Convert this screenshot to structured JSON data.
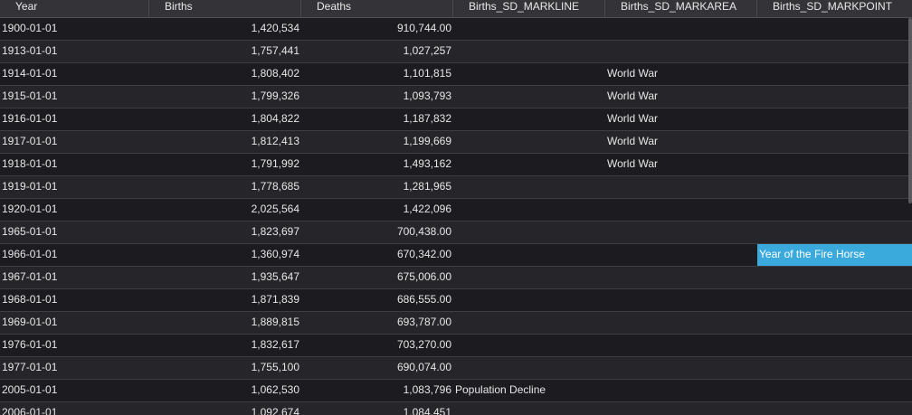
{
  "columns": [
    "Year",
    "Births",
    "Deaths",
    "Births_SD_MARKLINE",
    "Births_SD_MARKAREA",
    "Births_SD_MARKPOINT"
  ],
  "rows": [
    [
      "1900-01-01",
      "1,420,534",
      "910,744.00",
      "",
      "",
      ""
    ],
    [
      "1913-01-01",
      "1,757,441",
      "1,027,257",
      "",
      "",
      ""
    ],
    [
      "1914-01-01",
      "1,808,402",
      "1,101,815",
      "",
      "World War",
      ""
    ],
    [
      "1915-01-01",
      "1,799,326",
      "1,093,793",
      "",
      "World War",
      ""
    ],
    [
      "1916-01-01",
      "1,804,822",
      "1,187,832",
      "",
      "World War",
      ""
    ],
    [
      "1917-01-01",
      "1,812,413",
      "1,199,669",
      "",
      "World War",
      ""
    ],
    [
      "1918-01-01",
      "1,791,992",
      "1,493,162",
      "",
      "World War",
      ""
    ],
    [
      "1919-01-01",
      "1,778,685",
      "1,281,965",
      "",
      "",
      ""
    ],
    [
      "1920-01-01",
      "2,025,564",
      "1,422,096",
      "",
      "",
      ""
    ],
    [
      "1965-01-01",
      "1,823,697",
      "700,438.00",
      "",
      "",
      ""
    ],
    [
      "1966-01-01",
      "1,360,974",
      "670,342.00",
      "",
      "",
      "Year of the Fire Horse"
    ],
    [
      "1967-01-01",
      "1,935,647",
      "675,006.00",
      "",
      "",
      ""
    ],
    [
      "1968-01-01",
      "1,871,839",
      "686,555.00",
      "",
      "",
      ""
    ],
    [
      "1969-01-01",
      "1,889,815",
      "693,787.00",
      "",
      "",
      ""
    ],
    [
      "1976-01-01",
      "1,832,617",
      "703,270.00",
      "",
      "",
      ""
    ],
    [
      "1977-01-01",
      "1,755,100",
      "690,074.00",
      "",
      "",
      ""
    ],
    [
      "2005-01-01",
      "1,062,530",
      "1,083,796",
      "Population Decline",
      "",
      ""
    ],
    [
      "2006-01-01",
      "1,092,674",
      "1,084,451",
      "",
      "",
      ""
    ]
  ],
  "highlight": {
    "row": 10,
    "col": 5,
    "color": "#3aa9dc"
  }
}
